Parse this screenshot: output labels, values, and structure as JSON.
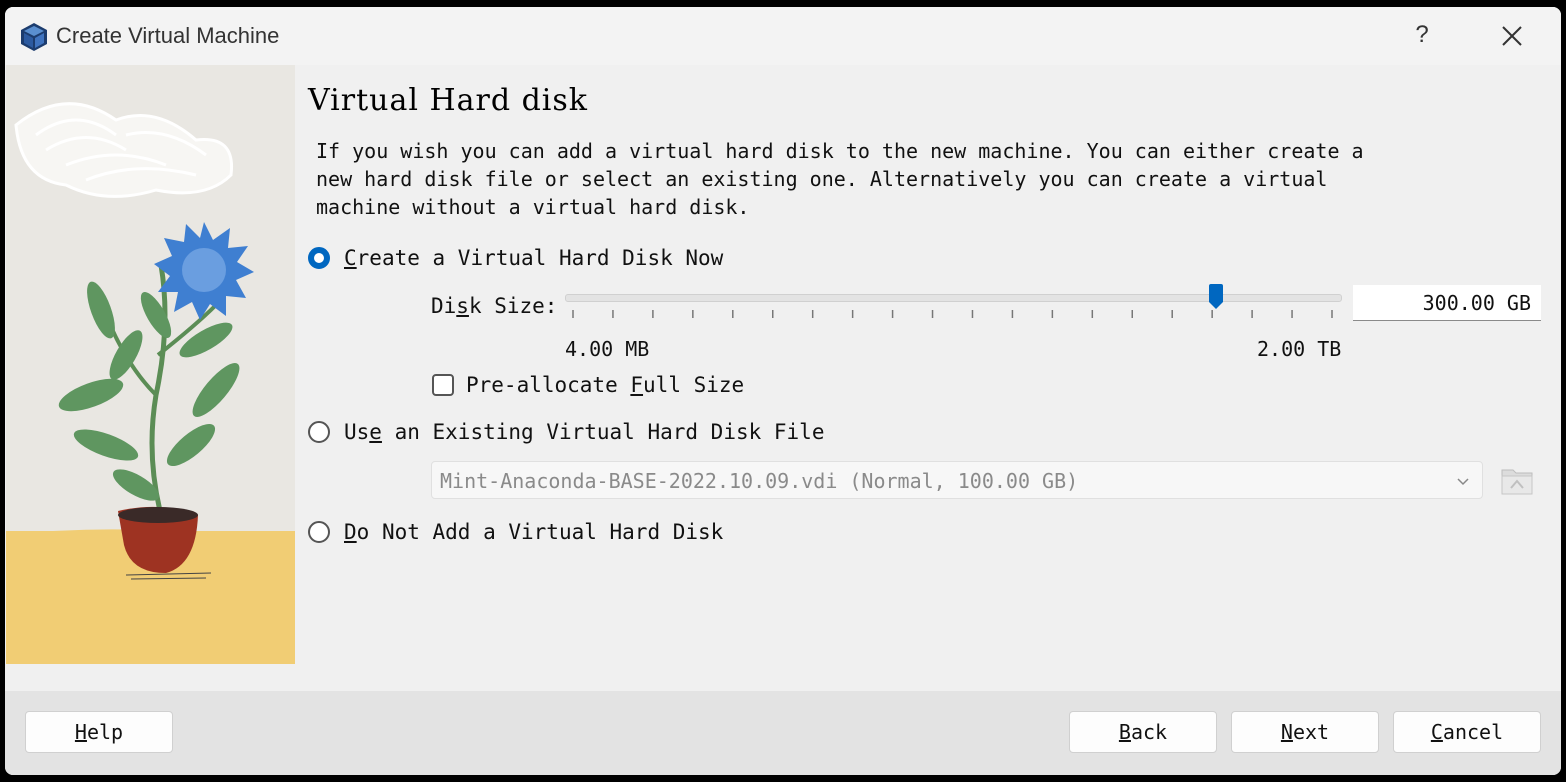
{
  "window": {
    "title": "Create Virtual Machine",
    "help_glyph": "?"
  },
  "page": {
    "heading": "Virtual Hard disk",
    "description": "If you wish you can add a virtual hard disk to the new machine. You can either create a new hard disk file or select an existing one. Alternatively you can create a virtual machine without a virtual hard disk."
  },
  "options": {
    "create_now": {
      "prefix": "",
      "mnemonic": "C",
      "rest": "reate a Virtual Hard Disk Now",
      "selected": true
    },
    "use_existing": {
      "prefix": "Us",
      "mnemonic": "e",
      "rest": " an Existing Virtual Hard Disk File",
      "selected": false
    },
    "do_not_add": {
      "prefix": "",
      "mnemonic": "D",
      "rest": "o Not Add a Virtual Hard Disk",
      "selected": false
    }
  },
  "disk_size": {
    "label_prefix": "Di",
    "label_mnemonic": "s",
    "label_rest": "k Size:",
    "min_label": "4.00 MB",
    "max_label": "2.00 TB",
    "value": "300.00 GB",
    "slider_fraction": 0.84,
    "tick_count": 20
  },
  "preallocate": {
    "prefix": "Pre-allocate ",
    "mnemonic": "F",
    "rest": "ull Size",
    "checked": false
  },
  "existing_file": {
    "selected": "Mint-Anaconda-BASE-2022.10.09.vdi (Normal, 100.00 GB)"
  },
  "buttons": {
    "help": {
      "mnemonic": "H",
      "rest": "elp"
    },
    "back": {
      "mnemonic": "B",
      "rest": "ack"
    },
    "next": {
      "mnemonic": "N",
      "rest": "ext"
    },
    "cancel": {
      "mnemonic": "C",
      "rest": "ancel"
    }
  },
  "colors": {
    "accent": "#0067c0",
    "window_bg": "#f0f0f0",
    "footer_bg": "#e3e3e3"
  },
  "icons": {
    "app": "virtualbox-cube-icon",
    "close": "close-icon",
    "chevron": "chevron-down-icon",
    "folder": "folder-icon"
  }
}
